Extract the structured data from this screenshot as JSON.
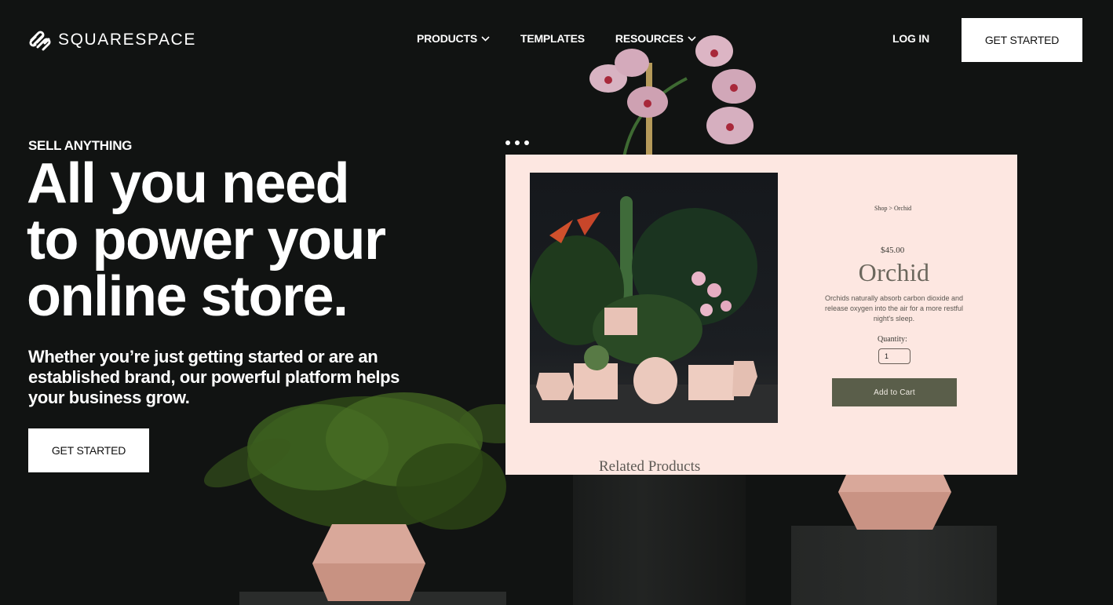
{
  "brand": {
    "name": "SQUARESPACE",
    "logo_icon": "squarespace-logo-icon"
  },
  "nav": {
    "items": [
      {
        "label": "PRODUCTS",
        "has_dropdown": true
      },
      {
        "label": "TEMPLATES",
        "has_dropdown": false
      },
      {
        "label": "RESOURCES",
        "has_dropdown": true
      }
    ],
    "login_label": "LOG IN",
    "cta_label": "GET STARTED"
  },
  "hero": {
    "eyebrow": "SELL ANYTHING",
    "headline_lines": [
      "All you need",
      "to power your",
      "online store."
    ],
    "subheadline": "Whether you’re just getting started or are an established brand, our powerful platform helps your business grow.",
    "cta_label": "GET STARTED"
  },
  "mockup": {
    "breadcrumb": "Shop  >  Orchid",
    "price": "$45.00",
    "product_title": "Orchid",
    "description": "Orchids naturally absorb carbon dioxide and release oxygen into the air for a more restful night's sleep.",
    "quantity_label": "Quantity:",
    "quantity_value": "1",
    "add_to_cart_label": "Add to Cart",
    "related_heading": "Related Products"
  },
  "colors": {
    "background": "#111312",
    "card_background": "#fde7e1",
    "add_to_cart": "#5a5e4a",
    "title_text": "#6b675d",
    "vase_pink": "#d8a898"
  }
}
